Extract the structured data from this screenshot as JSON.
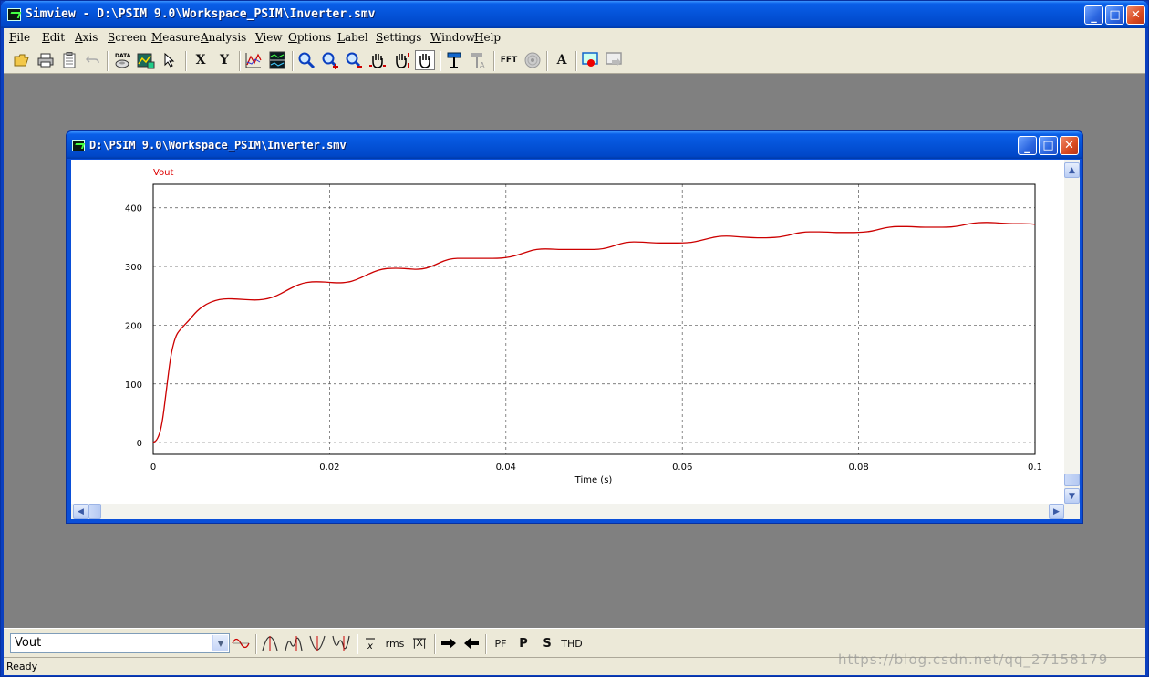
{
  "window": {
    "title": "Simview - D:\\PSIM 9.0\\Workspace_PSIM\\Inverter.smv"
  },
  "menu": [
    "File",
    "Edit",
    "Axis",
    "Screen",
    "Measure",
    "Analysis",
    "View",
    "Options",
    "Label",
    "Settings",
    "Window",
    "Help"
  ],
  "toolbar": {
    "x_label": "X",
    "y_label": "Y",
    "fft_label": "FFT",
    "text_label": "A"
  },
  "child": {
    "title": "D:\\PSIM 9.0\\Workspace_PSIM\\Inverter.smv"
  },
  "chart_data": {
    "type": "line",
    "title": "",
    "xlabel": "Time (s)",
    "ylabel": "",
    "xlim": [
      0,
      0.1
    ],
    "ylim": [
      -20,
      440
    ],
    "xticks": [
      0,
      0.02,
      0.04,
      0.06,
      0.08,
      0.1
    ],
    "xtick_labels": [
      "0",
      "0.02",
      "0.04",
      "0.06",
      "0.08",
      "0.1"
    ],
    "yticks": [
      0,
      100,
      200,
      300,
      400
    ],
    "ytick_labels": [
      "0",
      "100",
      "200",
      "300",
      "400"
    ],
    "grid": true,
    "series": [
      {
        "name": "Vout",
        "color": "#cc0000",
        "x": [
          0,
          0.0005,
          0.001,
          0.0015,
          0.002,
          0.0025,
          0.003,
          0.004,
          0.005,
          0.006,
          0.007,
          0.008,
          0.009,
          0.01,
          0.011,
          0.012,
          0.013,
          0.014,
          0.015,
          0.016,
          0.017,
          0.018,
          0.019,
          0.02,
          0.021,
          0.022,
          0.023,
          0.024,
          0.025,
          0.026,
          0.027,
          0.028,
          0.029,
          0.03,
          0.031,
          0.032,
          0.033,
          0.034,
          0.035,
          0.036,
          0.037,
          0.038,
          0.039,
          0.04,
          0.041,
          0.042,
          0.043,
          0.044,
          0.045,
          0.046,
          0.047,
          0.048,
          0.049,
          0.05,
          0.051,
          0.052,
          0.053,
          0.054,
          0.055,
          0.056,
          0.057,
          0.058,
          0.059,
          0.06,
          0.061,
          0.062,
          0.063,
          0.064,
          0.065,
          0.066,
          0.067,
          0.068,
          0.069,
          0.07,
          0.071,
          0.072,
          0.073,
          0.074,
          0.075,
          0.076,
          0.077,
          0.078,
          0.079,
          0.08,
          0.081,
          0.082,
          0.083,
          0.084,
          0.085,
          0.086,
          0.087,
          0.088,
          0.089,
          0.09,
          0.091,
          0.092,
          0.093,
          0.094,
          0.095,
          0.096,
          0.097,
          0.098,
          0.099,
          0.1
        ],
        "y": [
          0,
          5,
          30,
          90,
          150,
          180,
          192,
          207,
          225,
          236,
          242,
          245,
          245,
          244,
          243,
          243,
          245,
          250,
          258,
          266,
          272,
          274,
          274,
          273,
          272,
          273,
          277,
          284,
          291,
          296,
          297,
          297,
          296,
          295,
          297,
          303,
          310,
          314,
          314,
          314,
          314,
          314,
          314,
          315,
          318,
          323,
          328,
          330,
          330,
          329,
          329,
          329,
          329,
          329,
          330,
          334,
          339,
          342,
          342,
          341,
          340,
          340,
          340,
          340,
          341,
          344,
          348,
          351,
          352,
          351,
          350,
          349,
          349,
          349,
          350,
          353,
          357,
          359,
          359,
          359,
          358,
          358,
          358,
          358,
          359,
          362,
          366,
          368,
          368,
          368,
          367,
          367,
          367,
          367,
          368,
          371,
          374,
          375,
          375,
          374,
          373,
          373,
          373,
          372
        ]
      }
    ]
  },
  "bottombar": {
    "signal_value": "Vout",
    "rms_label": "rms",
    "absavg_label": "|X|",
    "pf_label": "PF",
    "p_label": "P",
    "s_label": "S",
    "thd_label": "THD"
  },
  "status": {
    "text": "Ready"
  },
  "watermark": "https://blog.csdn.net/qq_27158179"
}
